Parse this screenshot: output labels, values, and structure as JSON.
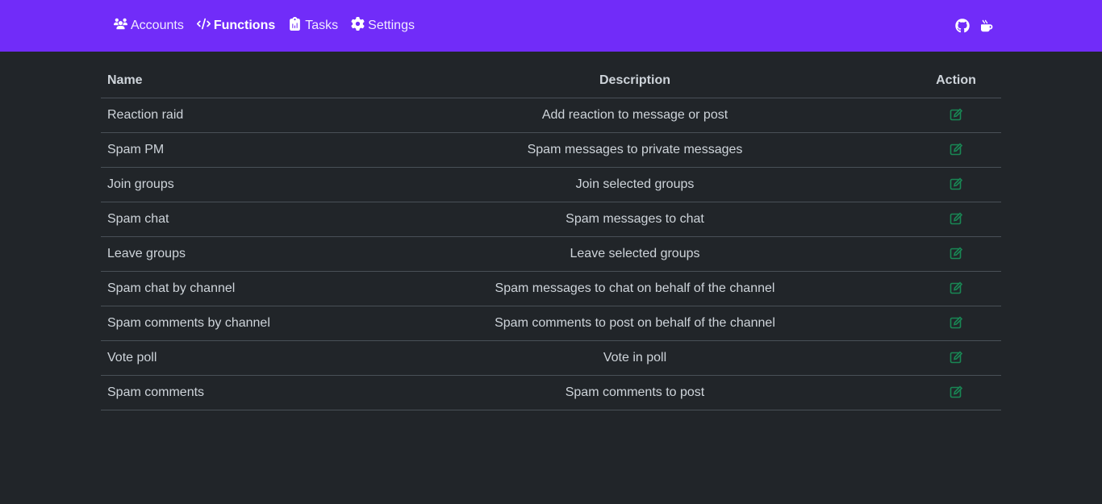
{
  "nav": {
    "items": [
      {
        "label": "Accounts",
        "icon": "users-icon"
      },
      {
        "label": "Functions",
        "icon": "code-icon",
        "active": true
      },
      {
        "label": "Tasks",
        "icon": "clipboard-icon"
      },
      {
        "label": "Settings",
        "icon": "gear-icon"
      }
    ],
    "right_icons": [
      "github-icon",
      "coffee-icon"
    ],
    "color": "#712cf9"
  },
  "table": {
    "headers": {
      "name": "Name",
      "description": "Description",
      "action": "Action"
    },
    "rows": [
      {
        "name": "Reaction raid",
        "description": "Add reaction to message or post"
      },
      {
        "name": "Spam PM",
        "description": "Spam messages to private messages"
      },
      {
        "name": "Join groups",
        "description": "Join selected groups"
      },
      {
        "name": "Spam chat",
        "description": "Spam messages to chat"
      },
      {
        "name": "Leave groups",
        "description": "Leave selected groups"
      },
      {
        "name": "Spam chat by channel",
        "description": "Spam messages to chat on behalf of the channel"
      },
      {
        "name": "Spam comments by channel",
        "description": "Spam comments to post on behalf of the channel"
      },
      {
        "name": "Vote poll",
        "description": "Vote in poll"
      },
      {
        "name": "Spam comments",
        "description": "Spam comments to post"
      }
    ],
    "action_icon": "edit-icon",
    "action_color": "#198754"
  }
}
